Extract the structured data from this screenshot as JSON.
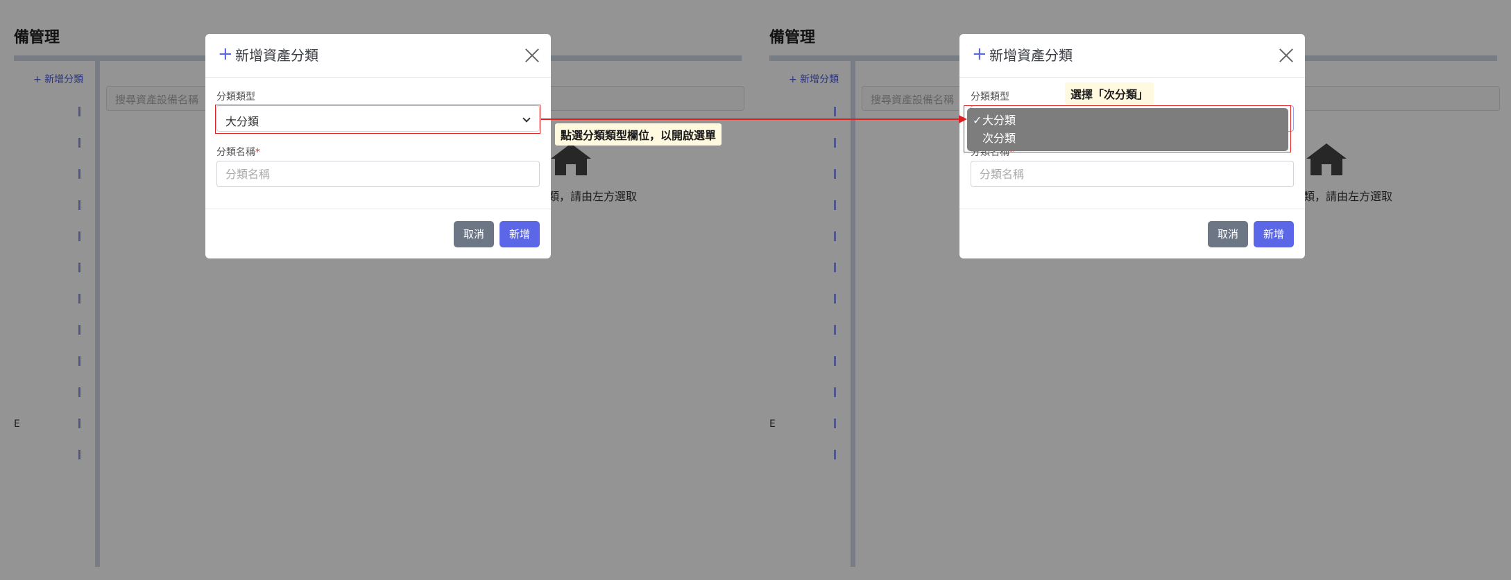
{
  "background": {
    "page_title": "備管理",
    "sidebar_add": "+ 新增分類",
    "search_placeholder": "搜尋資產設備名稱",
    "empty_text": "產分類，請由左方選取",
    "stub_text": "E"
  },
  "modal": {
    "title": "新增資產分類",
    "type_label": "分類類型",
    "type_value": "大分類",
    "name_label": "分類名稱",
    "required_mark": "*",
    "name_placeholder": "分類名稱",
    "cancel_label": "取消",
    "add_label": "新增"
  },
  "dropdown": {
    "check": "✓",
    "options": [
      "大分類",
      "次分類"
    ],
    "selected_index": 0
  },
  "annotations": {
    "step1": "點選分類類型欄位，以開啟選單",
    "step2": "選擇「次分類」"
  },
  "colors": {
    "accent": "#5b67e6",
    "cancel": "#6c7685",
    "highlight": "#e02020",
    "callout_bg": "#fff9e0"
  }
}
